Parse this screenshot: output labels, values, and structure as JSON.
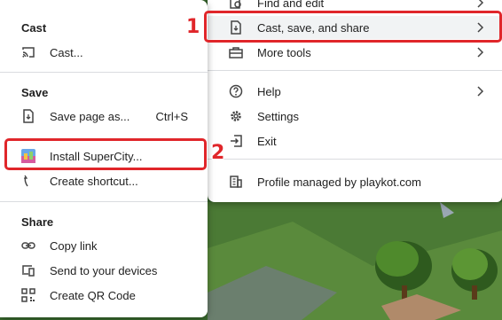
{
  "main_menu": {
    "find_edit": "Find and edit",
    "cast_save_share": "Cast, save, and share",
    "more_tools": "More tools",
    "help": "Help",
    "settings": "Settings",
    "exit": "Exit",
    "profile": "Profile managed by playkot.com"
  },
  "sub_menu": {
    "cast_title": "Cast",
    "cast_item": "Cast...",
    "save_title": "Save",
    "save_page": "Save page as...",
    "save_page_shortcut": "Ctrl+S",
    "install_app": "Install SuperCity...",
    "create_shortcut": "Create shortcut...",
    "share_title": "Share",
    "copy_link": "Copy link",
    "send_devices": "Send to your devices",
    "qr_code": "Create QR Code"
  },
  "annotations": {
    "step1": "1",
    "step2": "2",
    "color": "#e0262a"
  },
  "icons": [
    "find-icon",
    "cast-save-share-icon",
    "toolbox-icon",
    "help-icon",
    "gear-icon",
    "exit-icon",
    "building-icon",
    "cast-icon",
    "save-page-icon",
    "app-icon",
    "shortcut-icon",
    "link-icon",
    "devices-icon",
    "qr-code-icon",
    "chevron-right-icon"
  ]
}
